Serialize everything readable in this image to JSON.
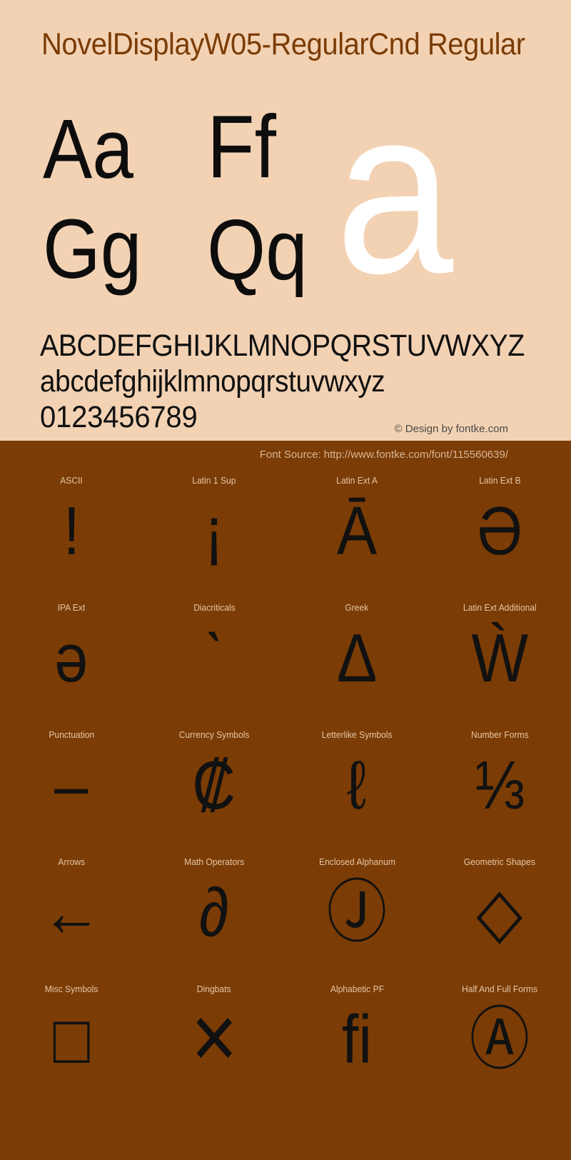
{
  "colors": {
    "top_background": "#f3d2b3",
    "bottom_background": "#7b3c05",
    "title": "#7a3c06",
    "glyph": "#111111",
    "watermark": "#ffffff",
    "label": "#e6c6a6",
    "credit": "#4a4a4a"
  },
  "header": {
    "font_title": "NovelDisplayW05-RegularCnd Regular"
  },
  "showcase": {
    "pairs": [
      {
        "name": "aa",
        "text": "Aa"
      },
      {
        "name": "ff",
        "text": "Ff"
      },
      {
        "name": "gg",
        "text": "Gg"
      },
      {
        "name": "qq",
        "text": "Qq"
      }
    ],
    "watermark_glyph": "a"
  },
  "alphabets": {
    "uppercase": "ABCDEFGHIJKLMNOPQRSTUVWXYZ",
    "lowercase": "abcdefghijklmnopqrstuvwxyz",
    "digits": "0123456789"
  },
  "credits": {
    "design": "© Design by fontke.com",
    "source": "Font Source: http://www.fontke.com/font/115560639/"
  },
  "unicode_blocks": [
    {
      "label": "ASCII",
      "glyph": "!"
    },
    {
      "label": "Latin 1 Sup",
      "glyph": "¡"
    },
    {
      "label": "Latin Ext A",
      "glyph": "Ā"
    },
    {
      "label": "Latin Ext B",
      "glyph": "Ə"
    },
    {
      "label": "IPA Ext",
      "glyph": "ə"
    },
    {
      "label": "Diacriticals",
      "glyph": "ˋ"
    },
    {
      "label": "Greek",
      "glyph": "Δ"
    },
    {
      "label": "Latin Ext Additional",
      "glyph": "Ẁ"
    },
    {
      "label": "Punctuation",
      "glyph": "–"
    },
    {
      "label": "Currency Symbols",
      "glyph": "₡"
    },
    {
      "label": "Letterlike Symbols",
      "glyph": "ℓ"
    },
    {
      "label": "Number Forms",
      "glyph": "⅓"
    },
    {
      "label": "Arrows",
      "glyph": "←"
    },
    {
      "label": "Math Operators",
      "glyph": "∂"
    },
    {
      "label": "Enclosed Alphanum",
      "glyph": "Ⓙ"
    },
    {
      "label": "Geometric Shapes",
      "glyph": "◇"
    },
    {
      "label": "Misc Symbols",
      "glyph": "□"
    },
    {
      "label": "Dingbats",
      "glyph": "✕"
    },
    {
      "label": "Alphabetic PF",
      "glyph": "ﬁ"
    },
    {
      "label": "Half And Full Forms",
      "glyph": "Ⓐ"
    }
  ]
}
